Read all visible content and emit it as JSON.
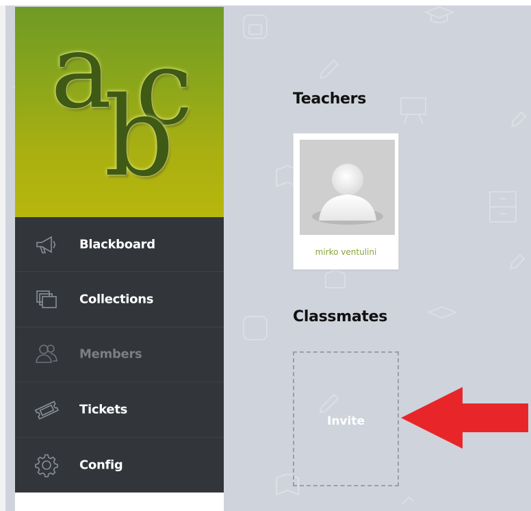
{
  "logo": {
    "letters": [
      "a",
      "c",
      "b"
    ]
  },
  "nav": {
    "items": [
      {
        "label": "Blackboard",
        "icon": "megaphone-icon",
        "disabled": false
      },
      {
        "label": "Collections",
        "icon": "collections-icon",
        "disabled": false
      },
      {
        "label": "Members",
        "icon": "members-icon",
        "disabled": true
      },
      {
        "label": "Tickets",
        "icon": "ticket-icon",
        "disabled": false
      },
      {
        "label": "Config",
        "icon": "gear-icon",
        "disabled": false
      }
    ]
  },
  "teachers": {
    "title": "Teachers",
    "list": [
      {
        "name": "mirko ventulini",
        "avatar": "default-user-avatar"
      }
    ]
  },
  "classmates": {
    "title": "Classmates",
    "invite_label": "Invite"
  },
  "colors": {
    "sidebar_bg": "#32363b",
    "main_bg": "#cfd3dc",
    "accent_green": "#8aa23a",
    "arrow_red": "#e8262a"
  }
}
